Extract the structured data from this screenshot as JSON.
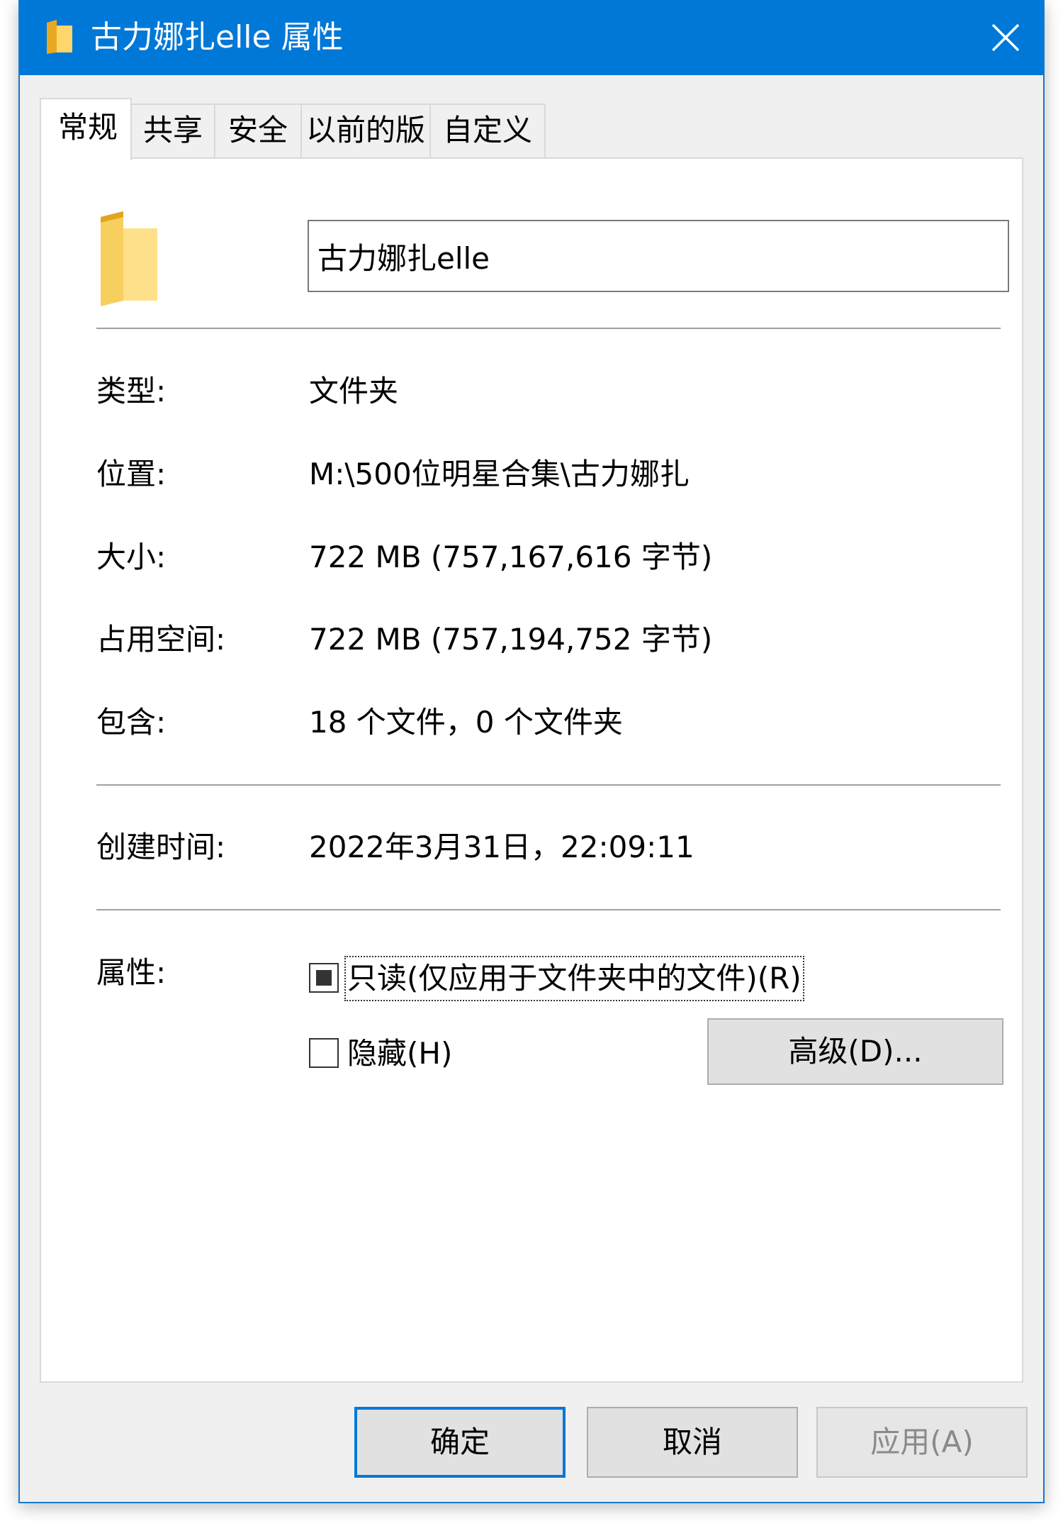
{
  "window": {
    "title": "古力娜扎elle 属性",
    "accent_color": "#0078d7",
    "title_icon": "folder-icon",
    "close_icon": "close-icon"
  },
  "tabs": [
    {
      "label": "常规",
      "active": true
    },
    {
      "label": "共享",
      "active": false
    },
    {
      "label": "安全",
      "active": false
    },
    {
      "label": "以前的版本",
      "active": false
    },
    {
      "label": "自定义",
      "active": false
    }
  ],
  "general": {
    "folder_icon": "folder-icon",
    "name_value": "古力娜扎elle",
    "details": [
      {
        "label": "类型:",
        "value": "文件夹"
      },
      {
        "label": "位置:",
        "value": "M:\\500位明星合集\\古力娜扎"
      },
      {
        "label": "大小:",
        "value": "722 MB (757,167,616 字节)"
      },
      {
        "label": "占用空间:",
        "value": "722 MB (757,194,752 字节)"
      },
      {
        "label": "包含:",
        "value": "18 个文件，0 个文件夹"
      }
    ],
    "created_label": "创建时间:",
    "created_value": "2022年3月31日，22:09:11",
    "attributes_label": "属性:",
    "readonly_label": "只读(仅应用于文件夹中的文件)(R)",
    "readonly_state": "indeterminate",
    "hidden_label": "隐藏(H)",
    "hidden_checked": false,
    "advanced_button": "高级(D)..."
  },
  "footer": {
    "ok": "确定",
    "cancel": "取消",
    "apply": "应用(A)",
    "apply_enabled": false
  }
}
